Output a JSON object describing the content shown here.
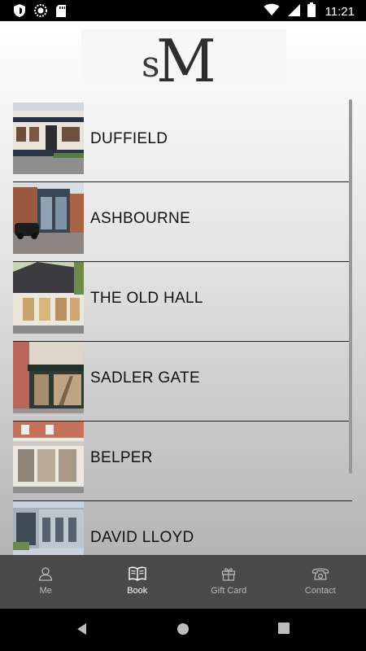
{
  "status_bar": {
    "time": "11:21",
    "icons": [
      "shield-icon",
      "circle-icon",
      "sd-card-icon",
      "wifi-icon",
      "signal-icon",
      "battery-icon"
    ]
  },
  "header": {
    "logo_text": "SM"
  },
  "locations": [
    {
      "label": "DUFFIELD"
    },
    {
      "label": "ASHBOURNE"
    },
    {
      "label": "THE OLD HALL"
    },
    {
      "label": "SADLER GATE"
    },
    {
      "label": "BELPER"
    },
    {
      "label": "DAVID LLOYD"
    }
  ],
  "tabs": [
    {
      "label": "Me",
      "icon": "person-icon",
      "active": false
    },
    {
      "label": "Book",
      "icon": "book-icon",
      "active": true
    },
    {
      "label": "Gift Card",
      "icon": "gift-icon",
      "active": false
    },
    {
      "label": "Contact",
      "icon": "phone-icon",
      "active": false
    }
  ],
  "nav_bar": {
    "buttons": [
      "back-icon",
      "home-icon",
      "recents-icon"
    ]
  },
  "colors": {
    "tab_bar": "#4a4a4a",
    "tab_active": "#ffffff",
    "tab_inactive": "#b9b9b9",
    "list_text": "#111111"
  }
}
